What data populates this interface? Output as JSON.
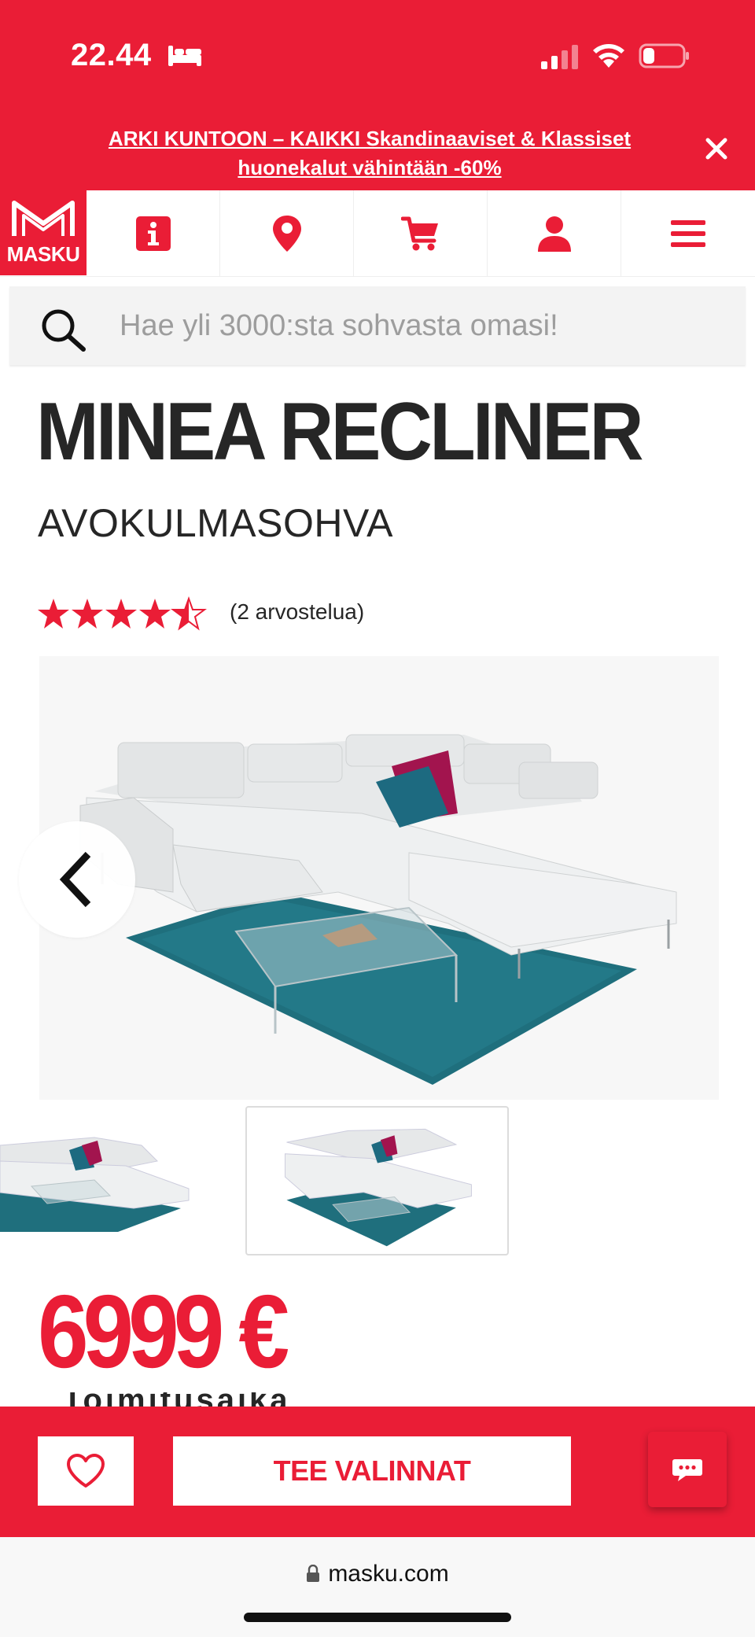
{
  "status_bar": {
    "time": "22.44",
    "icons": [
      "bed-icon",
      "signal-icon",
      "wifi-icon",
      "battery-icon"
    ]
  },
  "promo": {
    "text": "ARKI KUNTOON – KAIKKI Skandinaaviset & Klassiset huonekalut vähintään -60%",
    "close_icon": "close-icon"
  },
  "nav": {
    "logo_text": "MASKU",
    "items": [
      "info-icon",
      "location-pin-icon",
      "cart-icon",
      "user-icon",
      "menu-icon"
    ]
  },
  "search": {
    "placeholder": "Hae yli 3000:sta sohvasta omasi!"
  },
  "product": {
    "title": "MINEA RECLINER",
    "subtitle": "AVOKULMASOHVA",
    "rating": 4.5,
    "rating_max": 5,
    "rating_count_text": "(2 arvostelua)",
    "price": "6999 €",
    "cut_text": "Toimitusaika"
  },
  "actions": {
    "select_label": "TEE VALINNAT"
  },
  "browser": {
    "url": "masku.com"
  },
  "colors": {
    "brand": "#ea1d36",
    "text": "#262626",
    "search_bg": "#f3f3f3"
  }
}
